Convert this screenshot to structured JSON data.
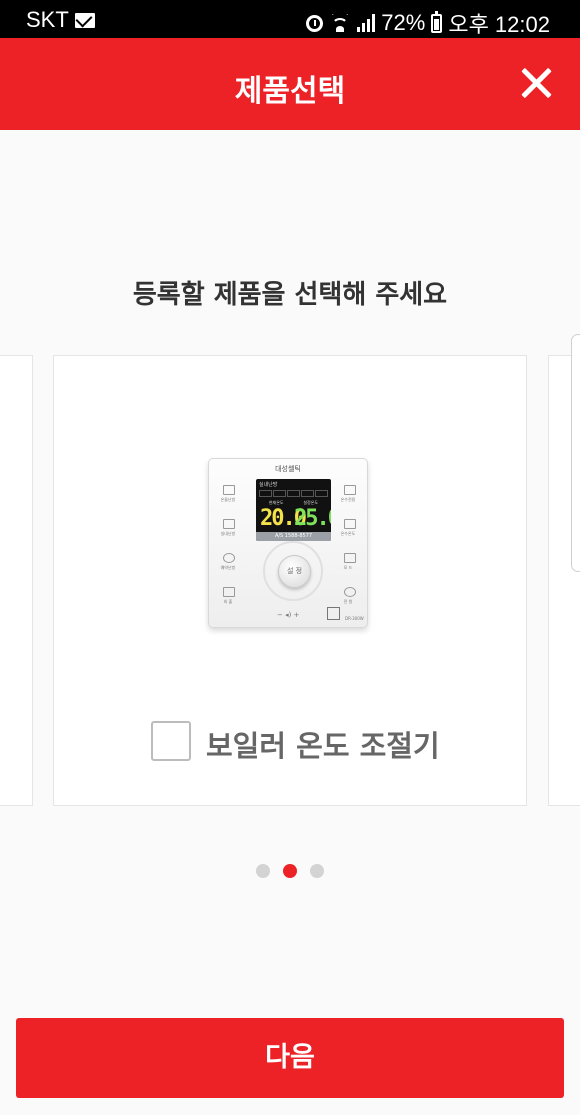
{
  "status_bar": {
    "carrier": "SKT",
    "battery": "72%",
    "time": "오후 12:02"
  },
  "header": {
    "title": "제품선택",
    "close_icon": "close-icon"
  },
  "instruction": "등록할 제품을 선택해 주세요",
  "carousel": {
    "total_pages": 3,
    "current_page": 2,
    "active_card": {
      "product_name": "보일러 온도 조절기",
      "checked": false,
      "device": {
        "brand": "대성쎌틱",
        "mode": "실내난방",
        "current_label": "현재온도",
        "set_label": "설정온도",
        "current_temp": "20.0",
        "set_temp": "25.0",
        "hotline": "A/S 1588-8577",
        "knob_label": "설 정",
        "left_buttons": [
          "온돌난방",
          "실내난방",
          "예약난방",
          "외 출"
        ],
        "right_buttons": [
          "온수전용",
          "온수온도",
          "모 드",
          "전 원"
        ],
        "model": "DR-300W"
      }
    }
  },
  "next_button": "다음",
  "colors": {
    "accent": "#ec2227",
    "background": "#fafafa",
    "dot_inactive": "#d3d3d3"
  }
}
